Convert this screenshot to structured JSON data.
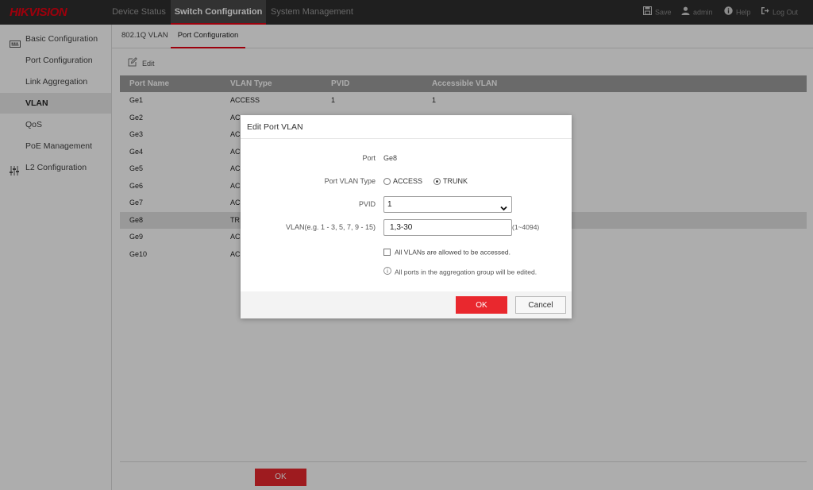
{
  "brand": {
    "logo_text": "HIKVISION",
    "accent": "#e60012"
  },
  "topnav": {
    "tabs": [
      {
        "label": "Device Status"
      },
      {
        "label": "Switch Configuration"
      },
      {
        "label": "System Management"
      }
    ],
    "active_tab": "Switch Configuration",
    "tools": {
      "save": "Save",
      "user": "admin",
      "help": "Help",
      "logout": "Log Out"
    }
  },
  "sidebar": {
    "items": [
      {
        "label": "Basic Configuration",
        "icon": "basic-config-icon"
      },
      {
        "label": "Port Configuration"
      },
      {
        "label": "Link Aggregation"
      },
      {
        "label": "VLAN"
      },
      {
        "label": "QoS"
      },
      {
        "label": "PoE Management"
      },
      {
        "label": "L2 Configuration",
        "icon": "sliders-icon"
      }
    ],
    "active": "VLAN"
  },
  "subtabs": {
    "items": [
      "802.1Q VLAN",
      "Port Configuration"
    ],
    "active": "Port Configuration"
  },
  "toolbar": {
    "edit_label": "Edit"
  },
  "table": {
    "headers": [
      "Port Name",
      "VLAN Type",
      "PVID",
      "Accessible VLAN"
    ],
    "rows": [
      [
        "Ge1",
        "ACCESS",
        "1",
        "1"
      ],
      [
        "Ge2",
        "AC",
        "",
        ""
      ],
      [
        "Ge3",
        "AC",
        "",
        ""
      ],
      [
        "Ge4",
        "AC",
        "",
        ""
      ],
      [
        "Ge5",
        "AC",
        "",
        ""
      ],
      [
        "Ge6",
        "AC",
        "",
        ""
      ],
      [
        "Ge7",
        "AC",
        "",
        ""
      ],
      [
        "Ge8",
        "TR",
        "",
        ""
      ],
      [
        "Ge9",
        "AC",
        "",
        ""
      ],
      [
        "Ge10",
        "AC",
        "",
        ""
      ]
    ],
    "selected_row": "Ge8"
  },
  "page_footer": {
    "ok_label": "OK"
  },
  "dialog": {
    "title": "Edit Port VLAN",
    "port_label": "Port",
    "port_value": "Ge8",
    "vlan_type_label": "Port VLAN Type",
    "vlan_type_options": [
      "ACCESS",
      "TRUNK"
    ],
    "vlan_type_selected": "TRUNK",
    "pvid_label": "PVID",
    "pvid_value": "1",
    "vlan_label": "VLAN(e.g. 1 - 3, 5, 7, 9 - 15)",
    "vlan_value": "1,3-30",
    "vlan_hint": "(1~4094)",
    "allow_all_label": "All VLANs are allowed to be accessed.",
    "allow_all_checked": false,
    "info_text": "All ports in the aggregation group will be edited.",
    "ok_label": "OK",
    "cancel_label": "Cancel"
  }
}
